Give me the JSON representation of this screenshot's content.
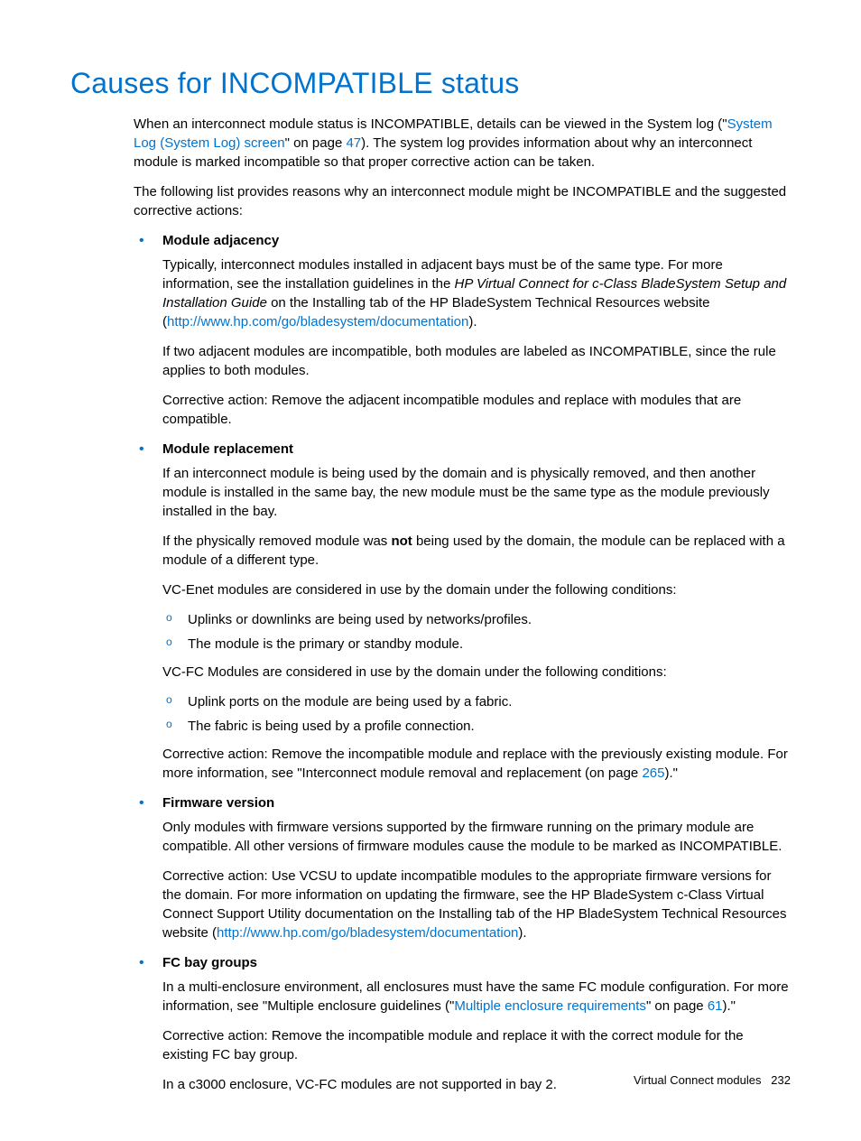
{
  "heading": "Causes for INCOMPATIBLE status",
  "intro": {
    "p1_a": "When an interconnect module status is INCOMPATIBLE, details can be viewed in the System log (\"",
    "p1_link": "System Log (System Log) screen",
    "p1_b": "\" on page ",
    "p1_page": "47",
    "p1_c": "). The system log provides information about why an interconnect module is marked incompatible so that proper corrective action can be taken.",
    "p2": "The following list provides reasons why an interconnect module might be INCOMPATIBLE and the suggested corrective actions:"
  },
  "items": {
    "adj": {
      "title": "Module adjacency",
      "p1_a": "Typically, interconnect modules installed in adjacent bays must be of the same type. For more information, see the installation guidelines in the ",
      "p1_i": "HP Virtual Connect for c-Class BladeSystem Setup and Installation Guide",
      "p1_b": " on the Installing tab of the HP BladeSystem Technical Resources website (",
      "p1_link": "http://www.hp.com/go/bladesystem/documentation",
      "p1_c": ").",
      "p2": "If two adjacent modules are incompatible, both modules are labeled as INCOMPATIBLE, since the rule applies to both modules.",
      "p3": "Corrective action: Remove the adjacent incompatible modules and replace with modules that are compatible."
    },
    "rep": {
      "title": "Module replacement",
      "p1": "If an interconnect module is being used by the domain and is physically removed, and then another module is installed in the same bay, the new module must be the same type as the module previously installed in the bay.",
      "p2_a": "If the physically removed module was ",
      "p2_b": "not",
      "p2_c": " being used by the domain, the module can be replaced with a module of a different type.",
      "p3": "VC-Enet modules are considered in use by the domain under the following conditions:",
      "sub1": {
        "a": "Uplinks or downlinks are being used by networks/profiles.",
        "b": "The module is the primary or standby module."
      },
      "p4": "VC-FC Modules are considered in use by the domain under the following conditions:",
      "sub2": {
        "a": "Uplink ports on the module are being used by a fabric.",
        "b": "The fabric is being used by a profile connection."
      },
      "p5_a": "Corrective action: Remove the incompatible module and replace with the previously existing module. For more information, see \"Interconnect module removal and replacement (on page ",
      "p5_page": "265",
      "p5_b": ").\""
    },
    "fw": {
      "title": "Firmware version",
      "p1": "Only modules with firmware versions supported by the firmware running on the primary module are compatible. All other versions of firmware modules cause the module to be marked as INCOMPATIBLE.",
      "p2_a": "Corrective action: Use VCSU to update incompatible modules to the appropriate firmware versions for the domain. For more information on updating the firmware, see the HP BladeSystem c-Class Virtual Connect Support Utility documentation on the Installing tab of the HP BladeSystem Technical Resources website (",
      "p2_link": "http://www.hp.com/go/bladesystem/documentation",
      "p2_b": ")."
    },
    "fc": {
      "title": "FC bay groups",
      "p1_a": "In a multi-enclosure environment, all enclosures must have the same FC module configuration. For more information, see \"Multiple enclosure guidelines (\"",
      "p1_link": "Multiple enclosure requirements",
      "p1_b": "\" on page ",
      "p1_page": "61",
      "p1_c": ").\"",
      "p2": "Corrective action: Remove the incompatible module and replace it with the correct module for the existing FC bay group.",
      "p3": "In a c3000 enclosure, VC-FC modules are not supported in bay 2."
    }
  },
  "footer": {
    "section": "Virtual Connect modules",
    "page": "232"
  }
}
